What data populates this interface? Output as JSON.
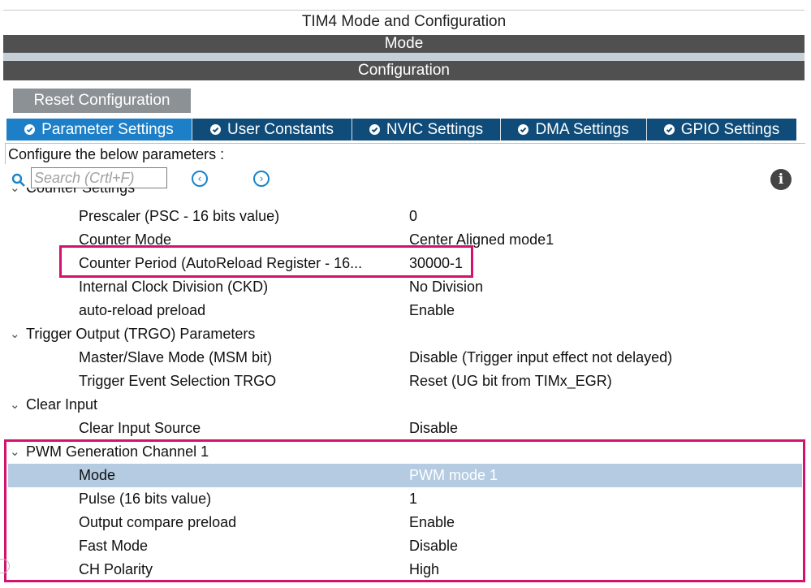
{
  "window": {
    "title": "TIM4 Mode and Configuration",
    "mode_label": "Mode",
    "configuration_label": "Configuration"
  },
  "toolbar": {
    "reset_label": "Reset Configuration"
  },
  "tabs": [
    {
      "label": "Parameter Settings",
      "active": true,
      "icon": "check-circle-icon"
    },
    {
      "label": "User Constants",
      "active": false,
      "icon": "check-circle-icon"
    },
    {
      "label": "NVIC Settings",
      "active": false,
      "icon": "check-circle-icon"
    },
    {
      "label": "DMA Settings",
      "active": false,
      "icon": "check-circle-icon"
    },
    {
      "label": "GPIO Settings",
      "active": false,
      "icon": "check-circle-icon"
    }
  ],
  "instructions": "Configure the below parameters :",
  "search": {
    "placeholder": "Search (Crtl+F)",
    "prev_icon": "chevron-left-icon",
    "next_icon": "chevron-right-icon",
    "info_icon": "info-icon"
  },
  "tree": {
    "partial_group": "Counter Settings",
    "counter_rows": [
      {
        "name": "Prescaler (PSC - 16 bits value)",
        "value": "0"
      },
      {
        "name": "Counter Mode",
        "value": "Center Aligned mode1"
      },
      {
        "name": "Counter Period (AutoReload Register - 16...",
        "value": "30000-1"
      },
      {
        "name": "Internal Clock Division (CKD)",
        "value": "No Division"
      },
      {
        "name": "auto-reload preload",
        "value": "Enable"
      }
    ],
    "trgo_group": "Trigger Output (TRGO) Parameters",
    "trgo_rows": [
      {
        "name": "Master/Slave Mode (MSM bit)",
        "value": "Disable (Trigger input effect not delayed)"
      },
      {
        "name": "Trigger Event Selection TRGO",
        "value": "Reset (UG bit from TIMx_EGR)"
      }
    ],
    "clear_group": "Clear Input",
    "clear_rows": [
      {
        "name": "Clear Input Source",
        "value": "Disable"
      }
    ],
    "pwm_group": "PWM Generation Channel 1",
    "pwm_rows": [
      {
        "name": "Mode",
        "value": "PWM mode 1",
        "selected": true
      },
      {
        "name": "Pulse (16 bits value)",
        "value": "1"
      },
      {
        "name": "Output compare preload",
        "value": "Enable"
      },
      {
        "name": "Fast Mode",
        "value": "Disable"
      },
      {
        "name": "CH Polarity",
        "value": "High"
      }
    ]
  },
  "colors": {
    "tab_bar": "#0f4c79",
    "tab_active": "#1d7fc7",
    "highlight_border": "#d4116f",
    "selected_row": "#b4cbe2",
    "header_bar": "#505050"
  }
}
